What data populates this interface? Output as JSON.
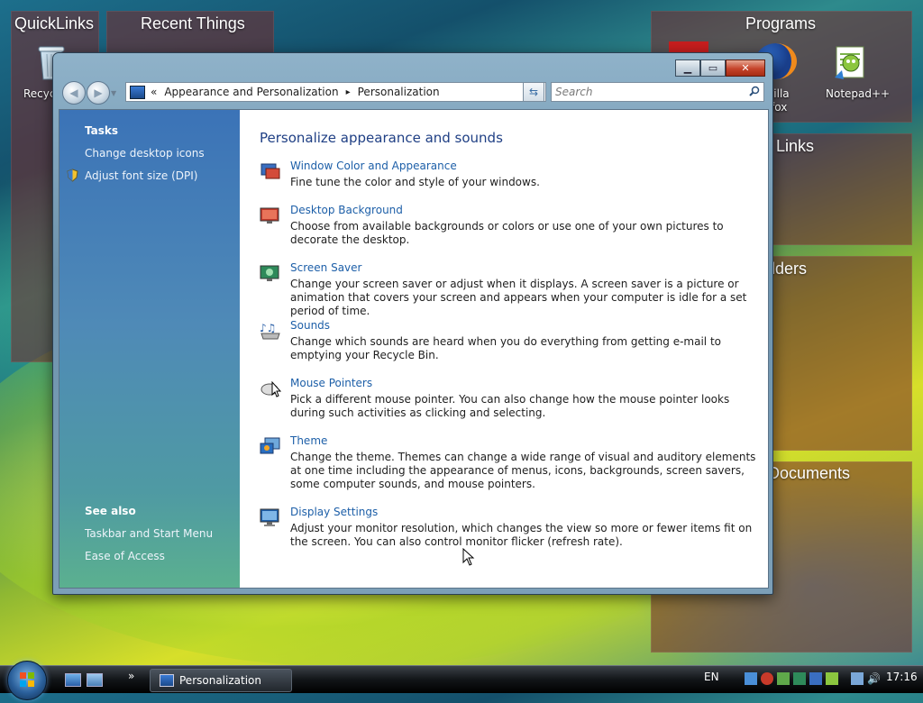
{
  "desktop": {
    "gadgets": {
      "quicklinks": "QuickLinks",
      "recent": "Recent Things",
      "programs": "Programs",
      "links_partial": "o Links",
      "folders_partial": "lders",
      "documents_partial": "Documents"
    },
    "icons": {
      "recycle": "Recyc",
      "firefox_line1": "zilla",
      "firefox_line2": "fox",
      "notepad": "Notepad++"
    }
  },
  "window": {
    "address": {
      "chevrons": "«",
      "crumb1": "Appearance and Personalization",
      "separator": "▸",
      "crumb2": "Personalization"
    },
    "search_placeholder": "Search",
    "sidebar": {
      "tasks_heading": "Tasks",
      "tasks": [
        "Change desktop icons",
        "Adjust font size (DPI)"
      ],
      "see_also_heading": "See also",
      "see_also": [
        "Taskbar and Start Menu",
        "Ease of Access"
      ]
    },
    "main": {
      "title": "Personalize appearance and sounds",
      "items": [
        {
          "link": "Window Color and Appearance",
          "desc": "Fine tune the color and style of your windows.",
          "icon": "window-color-icon"
        },
        {
          "link": "Desktop Background",
          "desc": "Choose from available backgrounds or colors or use one of your own pictures to decorate the desktop.",
          "icon": "desktop-background-icon"
        },
        {
          "link": "Screen Saver",
          "desc": "Change your screen saver or adjust when it displays. A screen saver is a picture or animation that covers your screen and appears when your computer is idle for a set period of time.",
          "icon": "screen-saver-icon"
        },
        {
          "link": "Sounds",
          "desc": "Change which sounds are heard when you do everything from getting e-mail to emptying your Recycle Bin.",
          "icon": "sounds-icon"
        },
        {
          "link": "Mouse Pointers",
          "desc": "Pick a different mouse pointer. You can also change how the mouse pointer looks during such activities as clicking and selecting.",
          "icon": "mouse-pointers-icon"
        },
        {
          "link": "Theme",
          "desc": "Change the theme. Themes can change a wide range of visual and auditory elements at one time including the appearance of menus, icons, backgrounds, screen savers, some computer sounds, and mouse pointers.",
          "icon": "theme-icon"
        },
        {
          "link": "Display Settings",
          "desc": "Adjust your monitor resolution, which changes the view so more or fewer items fit on the screen. You can also control monitor flicker (refresh rate).",
          "icon": "display-settings-icon"
        }
      ]
    }
  },
  "taskbar": {
    "quicklaunch_more": "»",
    "active_window": "Personalization",
    "language": "EN",
    "clock": "17:16"
  }
}
